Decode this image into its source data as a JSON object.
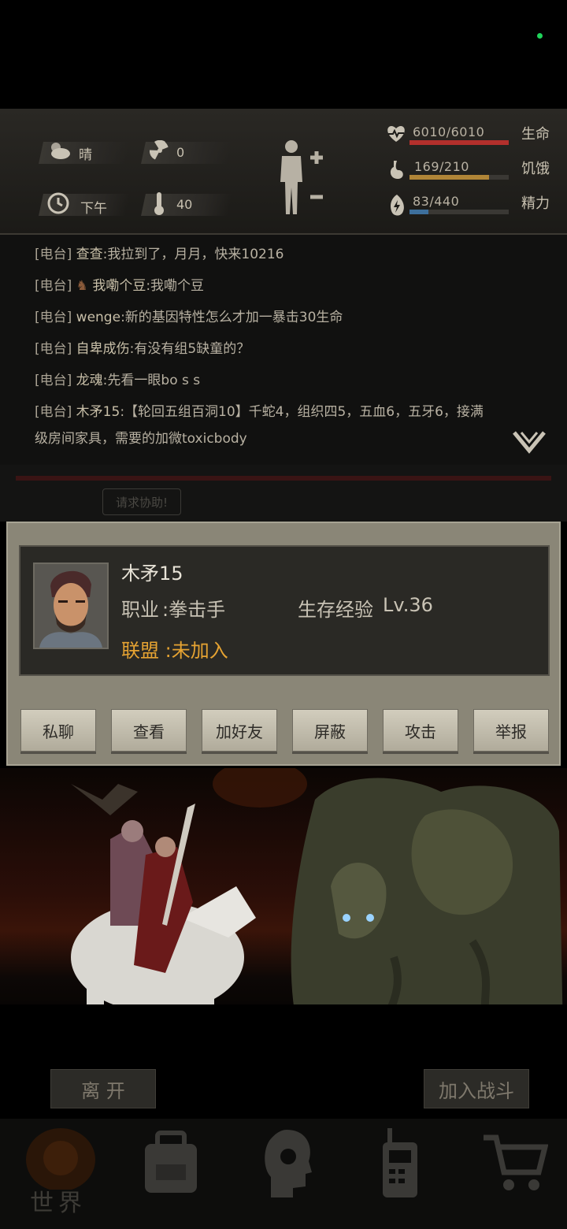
{
  "status": {
    "weather": {
      "icon": "cloud-sun-icon",
      "value": "晴"
    },
    "radiation": {
      "icon": "radiation-icon",
      "value": "0"
    },
    "time": {
      "icon": "clock-icon",
      "value": "下午"
    },
    "temperature": {
      "icon": "thermometer-icon",
      "value": "40"
    },
    "health": {
      "icon": "heart-icon",
      "label": "6010/6010",
      "name": "生命",
      "fraction": 1.0,
      "color": "#b3302c"
    },
    "hunger": {
      "icon": "stomach-icon",
      "label": "169/210",
      "name": "饥饿",
      "fraction": 0.805,
      "color": "#b08537"
    },
    "energy": {
      "icon": "energy-icon",
      "label": "83/440",
      "name": "精力",
      "fraction": 0.189,
      "color": "#3d6f9c"
    }
  },
  "chat": {
    "tag": "[电台]",
    "lines": [
      {
        "name": "查查",
        "text": ":我拉到了，月月，快来10216"
      },
      {
        "name": "我嘞个豆",
        "text": ":我嘞个豆"
      },
      {
        "name": "wenge",
        "text": ":新的基因特性怎么才加一暴击30生命"
      },
      {
        "name": "自卑成伤",
        "text": ":有没有组5缺童的？"
      },
      {
        "name": "龙魂",
        "text": ":先看一眼bo s s"
      },
      {
        "name": "木矛15",
        "text": ":【轮回五组百洞10】千蛇4，组织四5，五血6，五牙6，接满"
      }
    ],
    "continuation": "级房间家具，需要的加微toxicbody",
    "partial_tab": "请求协助!"
  },
  "profile": {
    "name": "木矛15",
    "job_label": "职业",
    "job": ":拳击手",
    "exp_label": "生存经验",
    "exp_value": "Lv.36",
    "alliance": "联盟 :未加入"
  },
  "actions": [
    "私聊",
    "查看",
    "加好友",
    "屏蔽",
    "攻击",
    "举报"
  ],
  "bottom": {
    "leave": "离 开",
    "join": "加入战斗",
    "world": "世界"
  }
}
